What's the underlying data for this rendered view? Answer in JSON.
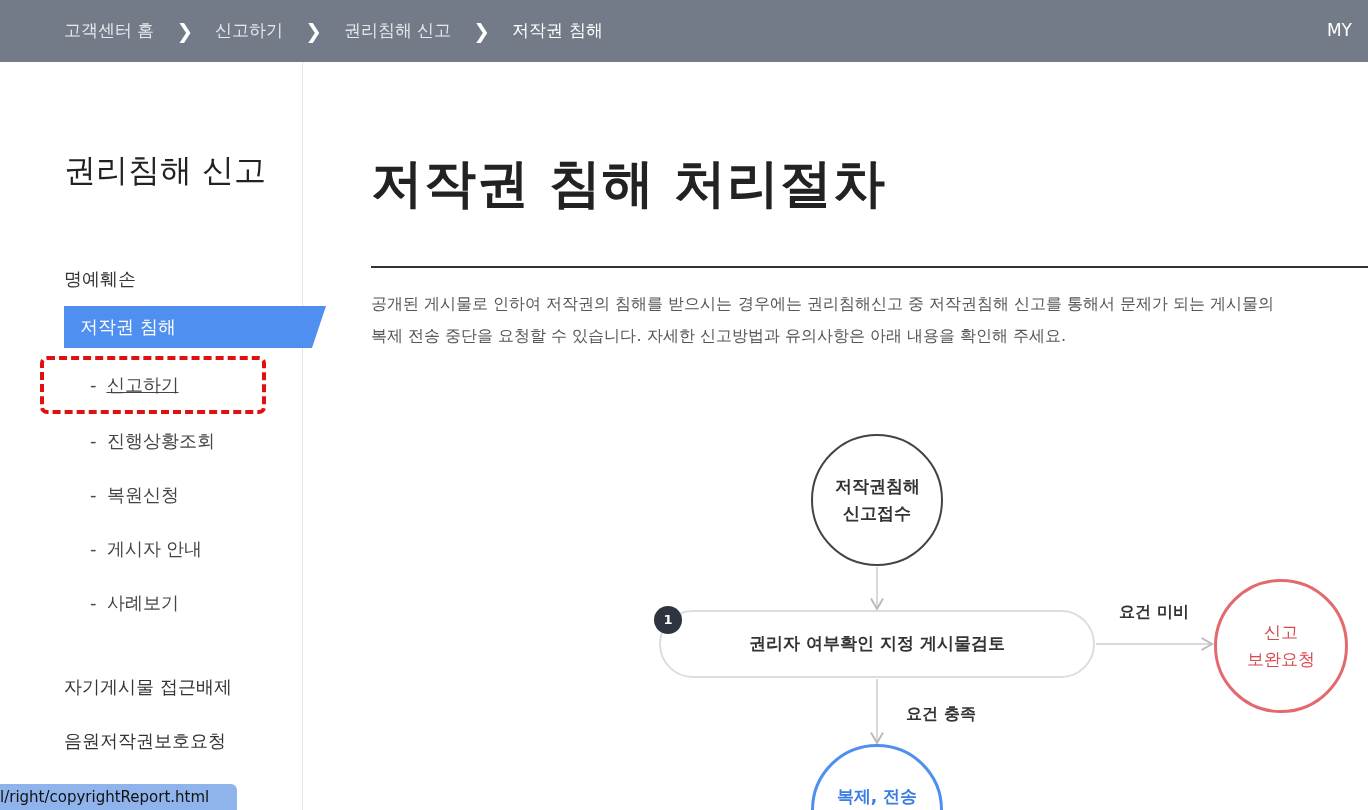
{
  "breadcrumb": [
    {
      "label": "고객센터 홈",
      "current": false
    },
    {
      "label": "신고하기",
      "current": false
    },
    {
      "label": "권리침해 신고",
      "current": false
    },
    {
      "label": "저작권 침해",
      "current": true
    }
  ],
  "separator": "❯",
  "user_menu": "MY",
  "sidebar": {
    "title": "권리침해 신고",
    "items": [
      {
        "label": "명예훼손",
        "selected": false
      },
      {
        "label": "저작권 침해",
        "selected": true,
        "children": [
          {
            "bullet": "-",
            "label": "신고하기",
            "selected": true,
            "highlighted": true
          },
          {
            "bullet": "-",
            "label": "진행상황조회",
            "selected": false,
            "highlighted": false
          },
          {
            "bullet": "-",
            "label": "복원신청",
            "selected": false,
            "highlighted": false
          },
          {
            "bullet": "-",
            "label": "게시자 안내",
            "selected": false,
            "highlighted": false
          },
          {
            "bullet": "-",
            "label": "사례보기",
            "selected": false,
            "highlighted": false
          }
        ]
      },
      {
        "label": "자기게시물 접근배제",
        "selected": false
      },
      {
        "label": "음원저작권보호요청",
        "selected": false
      }
    ]
  },
  "main": {
    "title": "저작권 침해 처리절차",
    "description": "공개된 게시물로 인하여 저작권의 침해를 받으시는 경우에는 권리침해신고 중 저작권침해 신고를 통해서 문제가 되는 게시물의 복제 전송 중단을 요청할 수 있습니다. 자세한 신고방법과 유의사항은 아래 내용을 확인해 주세요.",
    "flowchart": {
      "nodes": [
        {
          "kind": "start",
          "lines": [
            "저작권침해",
            "신고접수"
          ]
        },
        {
          "kind": "step",
          "lines": [
            "권리자 여부확인 지정 게시물검토"
          ],
          "number": "1"
        },
        {
          "kind": "reject",
          "lines": [
            "신고",
            "보완요청"
          ]
        },
        {
          "kind": "result",
          "lines": [
            "복제, 전송"
          ]
        }
      ],
      "edges": [
        {
          "kind": "down"
        },
        {
          "kind": "right",
          "label": "요건 미비"
        },
        {
          "kind": "down2",
          "label": "요건 충족"
        }
      ]
    }
  },
  "status_url": "l/right/copyrightReport.html"
}
